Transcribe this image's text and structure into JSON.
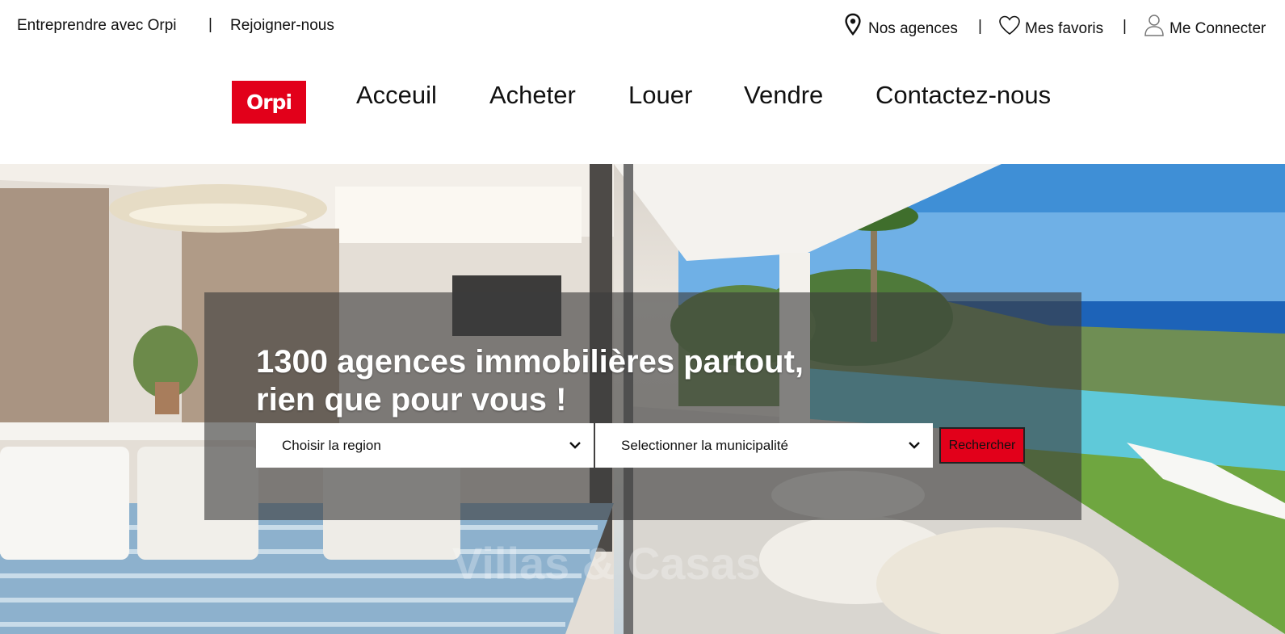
{
  "topbar": {
    "left_links": [
      "Entreprendre avec Orpi",
      "Rejoigner-nous"
    ],
    "separator": "|",
    "agencies_label": "Nos agences",
    "favorites_label": "Mes favoris",
    "login_label": "Me Connecter",
    "icons": {
      "agencies": "map-pin-icon",
      "favorites": "heart-icon",
      "login": "user-icon"
    }
  },
  "brand": {
    "logo_text": "Orpi",
    "logo_color": "#e2001a"
  },
  "nav": {
    "items": [
      "Acceuil",
      "Acheter",
      "Louer",
      "Vendre",
      "Contactez-nous"
    ]
  },
  "hero": {
    "headline_line1": "1300 agences immobilières partout,",
    "headline_line2": "rien que pour vous !",
    "region_select": {
      "value": "Choisir la region"
    },
    "municipality_select": {
      "value": "Selectionner la municipalité"
    },
    "search_button": "Rechercher",
    "watermark": "Villas & Casas",
    "colors": {
      "button": "#e2001a",
      "overlay": "rgba(60,60,60,0.62)"
    }
  }
}
